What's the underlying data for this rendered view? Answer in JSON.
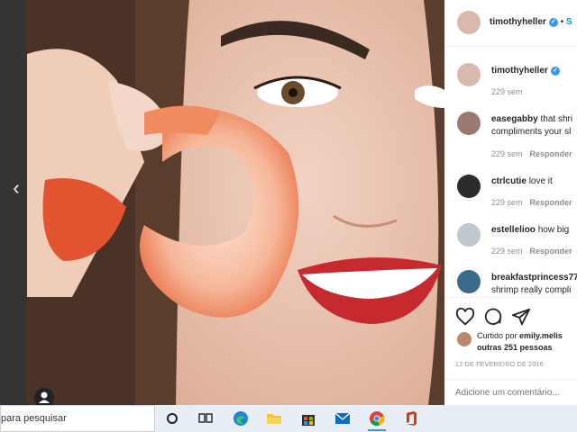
{
  "post_header": {
    "username": "timothyheller",
    "follow_label": "S"
  },
  "comments": [
    {
      "username": "timothyheller",
      "text": "",
      "time": "229 sem",
      "reply": ""
    },
    {
      "username": "easegabby",
      "text": "that shri",
      "text2": "compliments your sl",
      "time": "229 sem",
      "reply": "Responder"
    },
    {
      "username": "ctrlcutie",
      "text": "love it",
      "time": "229 sem",
      "reply": "Responder"
    },
    {
      "username": "estellelioo",
      "text": "how big",
      "time": "229 sem",
      "reply": "Responder"
    },
    {
      "username": "breakfastprincess77",
      "text": "",
      "text2": "shrimp really compli",
      "time": "",
      "reply": ""
    }
  ],
  "likes": {
    "prefix": "Curtido por",
    "user": "emily.melis",
    "rest": "outras 251 pessoas"
  },
  "date": "12 DE FEVEREIRO DE 2016",
  "comment_input": {
    "placeholder": "Adicione um comentário..."
  },
  "taskbar": {
    "search_text": "para pesquisar"
  },
  "icons": [
    "chevron-left-icon",
    "user-tag-icon",
    "verified-icon",
    "heart-icon",
    "comment-icon",
    "share-icon",
    "task-view-icon",
    "widgets-icon",
    "edge-icon",
    "file-explorer-icon",
    "store-icon",
    "mail-icon",
    "chrome-icon",
    "office-icon"
  ],
  "colors": {
    "accent": "#0095f6",
    "verified": "#3897f0",
    "taskbar": "#e8eef5"
  }
}
